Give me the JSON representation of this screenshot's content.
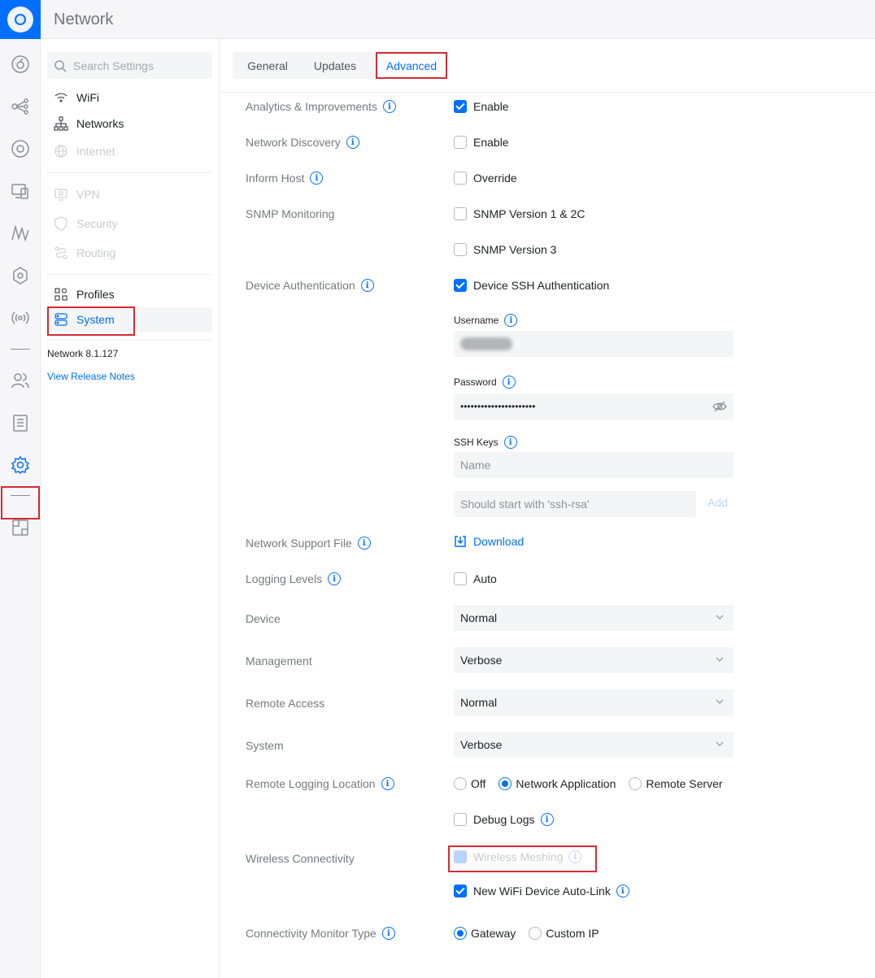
{
  "app": {
    "title": "Network"
  },
  "search": {
    "placeholder": "Search Settings"
  },
  "nav": {
    "items": [
      {
        "label": "WiFi",
        "icon": "wifi-icon"
      },
      {
        "label": "Networks",
        "icon": "network-tree-icon"
      },
      {
        "label": "Internet",
        "icon": "globe-icon"
      },
      {
        "label": "VPN",
        "icon": "vpn-icon"
      },
      {
        "label": "Security",
        "icon": "shield-icon"
      },
      {
        "label": "Routing",
        "icon": "routing-icon"
      },
      {
        "label": "Profiles",
        "icon": "profiles-icon"
      },
      {
        "label": "System",
        "icon": "system-icon"
      }
    ],
    "version": "Network 8.1.127",
    "release_notes": "View Release Notes"
  },
  "tabs": {
    "general": "General",
    "updates": "Updates",
    "advanced": "Advanced"
  },
  "settings": {
    "analytics": {
      "label": "Analytics & Improvements",
      "option": "Enable",
      "checked": true
    },
    "discovery": {
      "label": "Network Discovery",
      "option": "Enable",
      "checked": false
    },
    "inform_host": {
      "label": "Inform Host",
      "option": "Override",
      "checked": false
    },
    "snmp": {
      "label": "SNMP Monitoring",
      "v1": "SNMP Version 1 & 2C",
      "v3": "SNMP Version 3"
    },
    "device_auth": {
      "label": "Device Authentication",
      "option": "Device SSH Authentication",
      "checked": true,
      "username_label": "Username",
      "password_label": "Password",
      "password_value": "••••••••••••••••••••••",
      "ssh_keys_label": "SSH Keys",
      "name_placeholder": "Name",
      "key_placeholder": "Should start with 'ssh-rsa'",
      "add": "Add"
    },
    "support_file": {
      "label": "Network Support File",
      "action": "Download"
    },
    "logging_levels": {
      "label": "Logging Levels",
      "option": "Auto",
      "checked": false
    },
    "device": {
      "label": "Device",
      "value": "Normal"
    },
    "management": {
      "label": "Management",
      "value": "Verbose"
    },
    "remote_access": {
      "label": "Remote Access",
      "value": "Normal"
    },
    "system": {
      "label": "System",
      "value": "Verbose"
    },
    "remote_logging": {
      "label": "Remote Logging Location",
      "options": [
        "Off",
        "Network Application",
        "Remote Server"
      ],
      "selected": "Network Application",
      "debug_logs": "Debug Logs"
    },
    "wireless": {
      "label": "Wireless Connectivity",
      "meshing": "Wireless Meshing",
      "auto_link": "New WiFi Device Auto-Link"
    },
    "monitor": {
      "label": "Connectivity Monitor Type",
      "options": [
        "Gateway",
        "Custom IP"
      ],
      "selected": "Gateway"
    }
  },
  "colors": {
    "accent": "#006fff",
    "highlight": "#d62b35"
  }
}
